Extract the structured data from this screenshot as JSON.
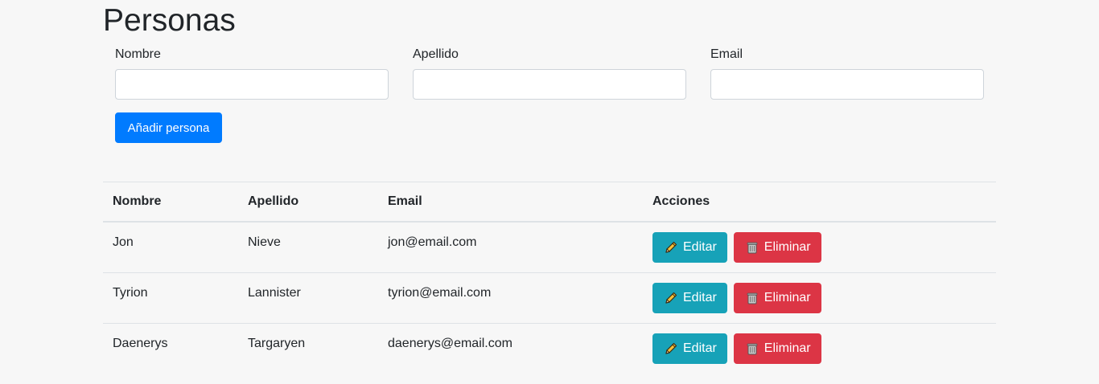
{
  "page": {
    "title": "Personas"
  },
  "form": {
    "fields": [
      {
        "label": "Nombre",
        "value": "",
        "placeholder": ""
      },
      {
        "label": "Apellido",
        "value": "",
        "placeholder": ""
      },
      {
        "label": "Email",
        "value": "",
        "placeholder": ""
      }
    ],
    "add_button_label": "Añadir persona"
  },
  "table": {
    "headers": [
      "Nombre",
      "Apellido",
      "Email",
      "Acciones"
    ],
    "rows": [
      {
        "nombre": "Jon",
        "apellido": "Nieve",
        "email": "jon@email.com",
        "edit_label": "Editar",
        "delete_label": "Eliminar"
      },
      {
        "nombre": "Tyrion",
        "apellido": "Lannister",
        "email": "tyrion@email.com",
        "edit_label": "Editar",
        "delete_label": "Eliminar"
      },
      {
        "nombre": "Daenerys",
        "apellido": "Targaryen",
        "email": "daenerys@email.com",
        "edit_label": "Editar",
        "delete_label": "Eliminar"
      }
    ]
  },
  "icons": {
    "edit": "pencil-icon",
    "delete": "trash-icon"
  },
  "colors": {
    "primary": "#007bff",
    "info": "#17a2b8",
    "danger": "#dc3545",
    "background": "#f7f7f7"
  }
}
